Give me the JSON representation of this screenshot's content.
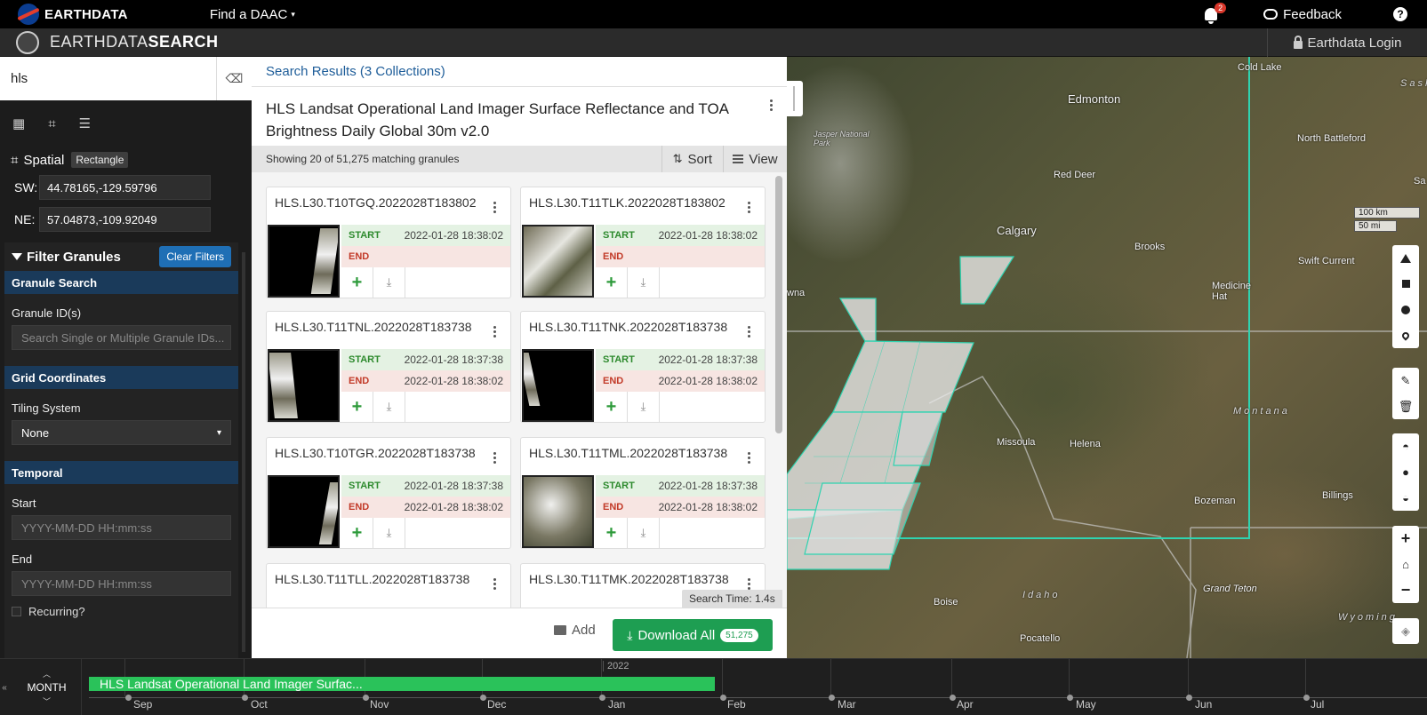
{
  "topbar": {
    "brand": "EARTHDATA",
    "find_daac": "Find a DAAC",
    "notification_count": "2",
    "feedback": "Feedback",
    "help": "?"
  },
  "app": {
    "title_light": "EARTHDATA",
    "title_bold": "SEARCH",
    "login": "Earthdata Login"
  },
  "sidebar": {
    "query": "hls",
    "spatial": {
      "label": "Spatial",
      "type": "Rectangle",
      "sw_label": "SW:",
      "sw_value": "44.78165,-129.59796",
      "ne_label": "NE:",
      "ne_value": "57.04873,-109.92049"
    },
    "filter": {
      "title": "Filter Granules",
      "clear": "Clear Filters",
      "granule_search": "Granule Search",
      "granule_ids_label": "Granule ID(s)",
      "granule_ids_placeholder": "Search Single or Multiple Granule IDs...",
      "grid_coordinates": "Grid Coordinates",
      "tiling_label": "Tiling System",
      "tiling_value": "None",
      "temporal": "Temporal",
      "start_label": "Start",
      "start_placeholder": "YYYY-MM-DD HH:mm:ss",
      "end_label": "End",
      "end_placeholder": "YYYY-MM-DD HH:mm:ss",
      "recurring": "Recurring?"
    }
  },
  "results": {
    "header": "Search Results (3 Collections)",
    "collection_title": "HLS Landsat Operational Land Imager Surface Reflectance and TOA Brightness Daily Global 30m v2.0",
    "showing": "Showing 20 of 51,275 matching granules",
    "sort": "Sort",
    "view": "View",
    "start_label": "START",
    "end_label": "END",
    "granules": [
      {
        "id": "HLS.L30.T10TGQ.2022028T183802",
        "start": "2022-01-28 18:38:02",
        "end": ""
      },
      {
        "id": "HLS.L30.T11TLK.2022028T183802",
        "start": "2022-01-28 18:38:02",
        "end": ""
      },
      {
        "id": "HLS.L30.T11TNL.2022028T183738",
        "start": "2022-01-28 18:37:38",
        "end": "2022-01-28 18:38:02"
      },
      {
        "id": "HLS.L30.T11TNK.2022028T183738",
        "start": "2022-01-28 18:37:38",
        "end": "2022-01-28 18:38:02"
      },
      {
        "id": "HLS.L30.T10TGR.2022028T183738",
        "start": "2022-01-28 18:37:38",
        "end": "2022-01-28 18:38:02"
      },
      {
        "id": "HLS.L30.T11TML.2022028T183738",
        "start": "2022-01-28 18:37:38",
        "end": "2022-01-28 18:38:02"
      },
      {
        "id": "HLS.L30.T11TLL.2022028T183738"
      },
      {
        "id": "HLS.L30.T11TMK.2022028T183738"
      }
    ],
    "search_time": "Search Time: 1.4s",
    "add": "Add",
    "download_all": "Download All",
    "download_count": "51,275"
  },
  "map": {
    "labels": [
      "Cold Lake",
      "Edmonton",
      "Jasper National Park",
      "Red Deer",
      "North Battleford",
      "Calgary",
      "Brooks",
      "Swift Current",
      "Medicine Hat",
      "Montana",
      "Missoula",
      "Helena",
      "Bozeman",
      "Billings",
      "Idaho",
      "Boise",
      "Grand Teton",
      "Wyoming",
      "Pocatello",
      "Sask",
      "Sa",
      "wna"
    ],
    "scale_km": "100 km",
    "scale_mi": "50 mi"
  },
  "timeline": {
    "zoom_level": "MONTH",
    "bar_label": "HLS Landsat Operational Land Imager Surfac...",
    "year": "2022",
    "months": [
      "Sep",
      "Oct",
      "Nov",
      "Dec",
      "Jan",
      "Feb",
      "Mar",
      "Apr",
      "May",
      "Jun",
      "Jul"
    ]
  }
}
